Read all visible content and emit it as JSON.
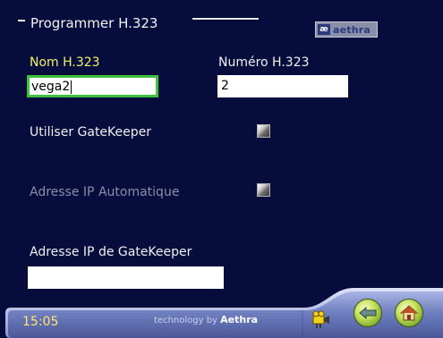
{
  "header": {
    "title": "Programmer H.323",
    "logo_mark": "æ",
    "logo_text": "aethra"
  },
  "form": {
    "nom_label": "Nom H.323",
    "nom_value": "vega2",
    "numero_label": "Numéro H.323",
    "numero_value": "2",
    "gatekeeper_label": "Utiliser GateKeeper",
    "gatekeeper_checked": false,
    "ip_auto_label": "Adresse IP Automatique",
    "ip_auto_checked": false,
    "gatekeeper_ip_label": "Adresse IP de GateKeeper",
    "gatekeeper_ip_value": ""
  },
  "footer": {
    "time": "15:05",
    "tech_prefix": "technology by",
    "tech_brand": "Aethra"
  },
  "icons": {
    "camera": "camera-icon",
    "back": "back-arrow-icon",
    "home": "home-icon"
  },
  "colors": {
    "background": "#060c3c",
    "active_label": "#f1f06a",
    "focus_border": "#3ec23e",
    "disabled_label": "#8a8ea8",
    "footer_bar": "#8090c8"
  }
}
